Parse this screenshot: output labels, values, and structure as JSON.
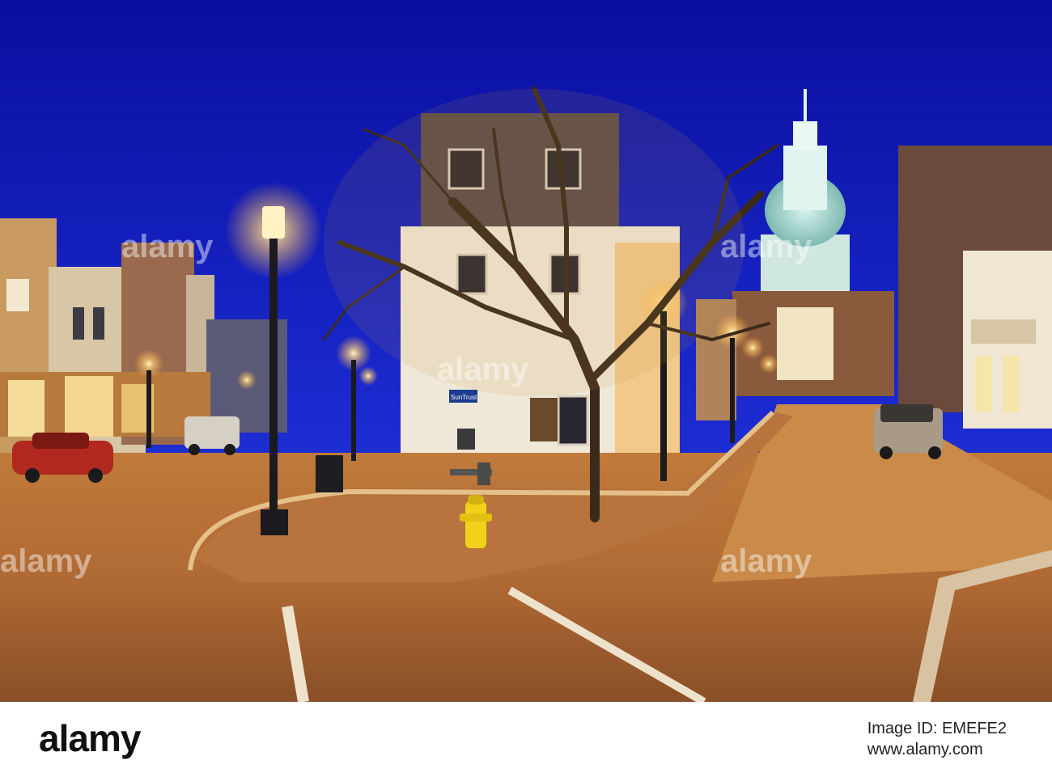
{
  "photo": {
    "watermark": "alamy",
    "atm_sign": "SunTrust"
  },
  "footer": {
    "logo": "alamy",
    "image_id_label": "Image ID: EMEFE2",
    "site": "www.alamy.com"
  },
  "colors": {
    "sky": "#1a24c8",
    "street_glow": "#d9954a",
    "lamp_light": "#ffd98a"
  }
}
